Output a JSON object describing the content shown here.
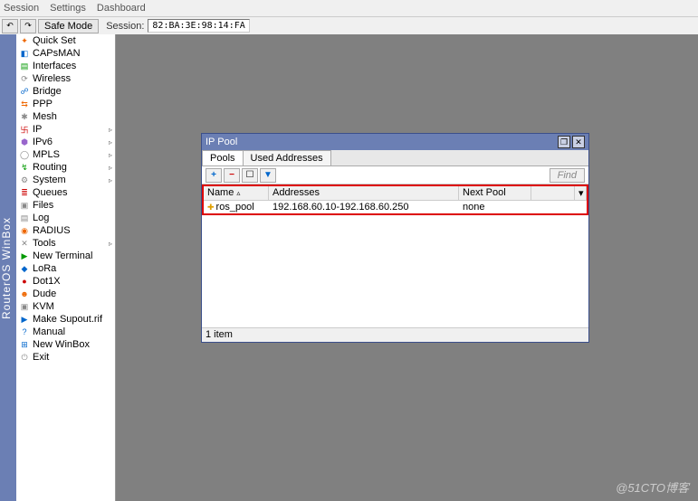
{
  "menubar": {
    "session": "Session",
    "settings": "Settings",
    "dashboard": "Dashboard"
  },
  "toolbar": {
    "safemode": "Safe Mode",
    "session_label": "Session:",
    "session_value": "82:BA:3E:98:14:FA"
  },
  "vtitle": "RouterOS WinBox",
  "sidebar": {
    "items": [
      {
        "label": "Quick Set",
        "ico": "✦",
        "cls": "i-orange"
      },
      {
        "label": "CAPsMAN",
        "ico": "◧",
        "cls": "i-blue"
      },
      {
        "label": "Interfaces",
        "ico": "▤",
        "cls": "i-green"
      },
      {
        "label": "Wireless",
        "ico": "⟳",
        "cls": "i-gray"
      },
      {
        "label": "Bridge",
        "ico": "☍",
        "cls": "i-blue"
      },
      {
        "label": "PPP",
        "ico": "⇆",
        "cls": "i-orange"
      },
      {
        "label": "Mesh",
        "ico": "✱",
        "cls": "i-gray"
      },
      {
        "label": "IP",
        "ico": "卐",
        "cls": "i-red",
        "arrow": true
      },
      {
        "label": "IPv6",
        "ico": "⬢",
        "cls": "i-purple",
        "arrow": true
      },
      {
        "label": "MPLS",
        "ico": "◯",
        "cls": "i-gray",
        "arrow": true
      },
      {
        "label": "Routing",
        "ico": "↯",
        "cls": "i-green",
        "arrow": true
      },
      {
        "label": "System",
        "ico": "⚙",
        "cls": "i-gray",
        "arrow": true
      },
      {
        "label": "Queues",
        "ico": "≣",
        "cls": "i-red"
      },
      {
        "label": "Files",
        "ico": "▣",
        "cls": "i-gray"
      },
      {
        "label": "Log",
        "ico": "▤",
        "cls": "i-gray"
      },
      {
        "label": "RADIUS",
        "ico": "◉",
        "cls": "i-orange"
      },
      {
        "label": "Tools",
        "ico": "✕",
        "cls": "i-gray",
        "arrow": true
      },
      {
        "label": "New Terminal",
        "ico": "▶",
        "cls": "i-green"
      },
      {
        "label": "LoRa",
        "ico": "◆",
        "cls": "i-blue"
      },
      {
        "label": "Dot1X",
        "ico": "●",
        "cls": "i-red"
      },
      {
        "label": "Dude",
        "ico": "☻",
        "cls": "i-orange"
      },
      {
        "label": "KVM",
        "ico": "▣",
        "cls": "i-gray"
      },
      {
        "label": "Make Supout.rif",
        "ico": "▶",
        "cls": "i-blue"
      },
      {
        "label": "Manual",
        "ico": "?",
        "cls": "i-blue"
      },
      {
        "label": "New WinBox",
        "ico": "⊞",
        "cls": "i-blue"
      },
      {
        "label": "Exit",
        "ico": "⏻",
        "cls": "i-gray"
      }
    ]
  },
  "win": {
    "title": "IP Pool",
    "tabs": {
      "pools": "Pools",
      "used": "Used Addresses"
    },
    "find": "Find",
    "columns": {
      "name": "Name",
      "addresses": "Addresses",
      "nextpool": "Next Pool"
    },
    "rows": [
      {
        "name": "ros_pool",
        "addresses": "192.168.60.10-192.168.60.250",
        "nextpool": "none"
      }
    ],
    "status": "1 item"
  },
  "watermark": "@51CTO博客"
}
